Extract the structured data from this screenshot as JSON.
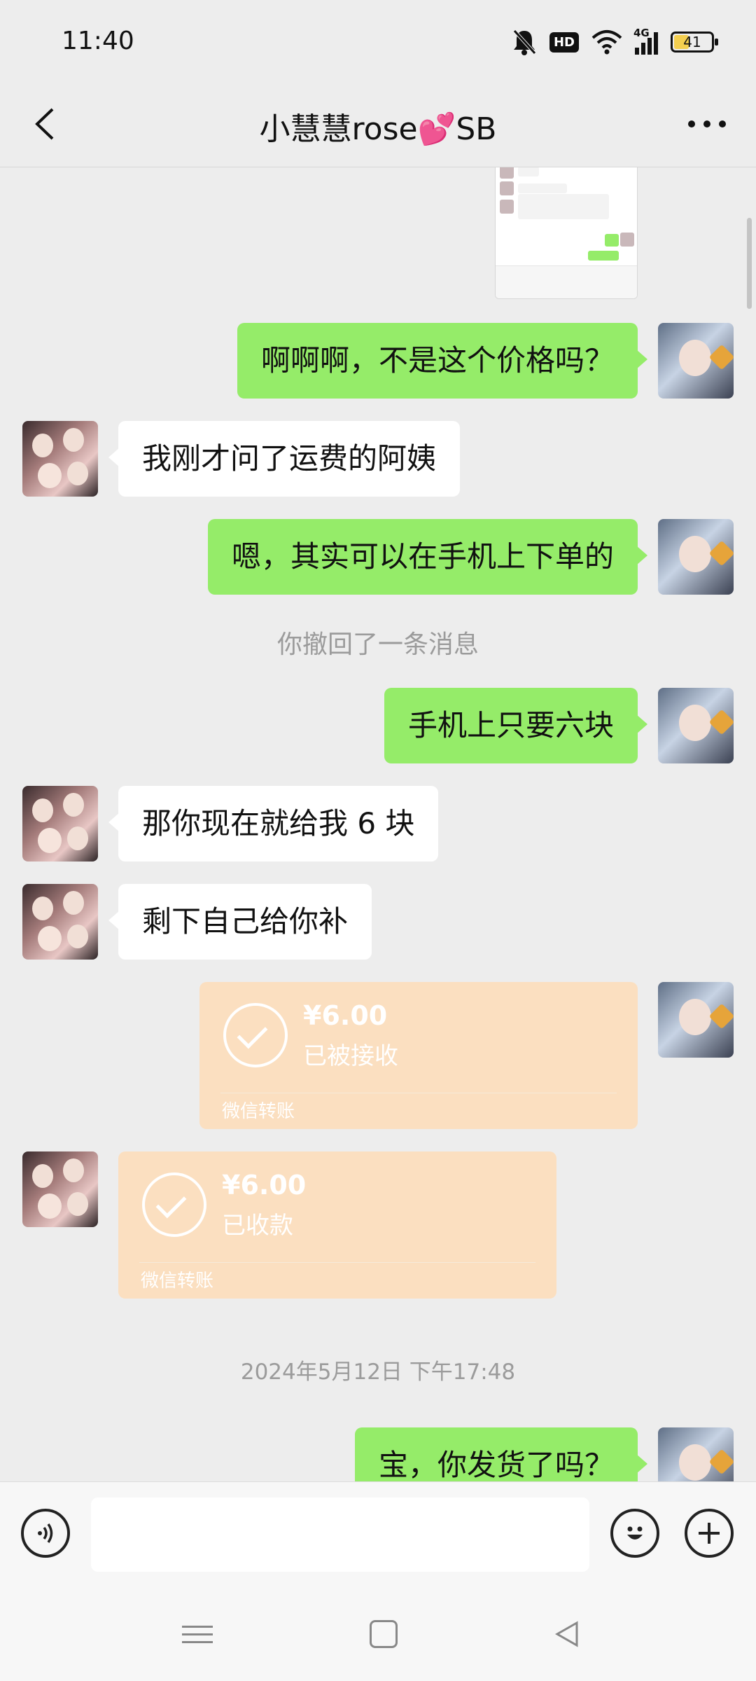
{
  "status_bar": {
    "time": "11:40",
    "network_label": "4G",
    "battery_level": "41",
    "battery_fraction": 0.41,
    "hd_label": "HD",
    "icons": [
      "mute-bell-icon",
      "hd-icon",
      "wifi-icon",
      "signal-icon",
      "battery-icon"
    ]
  },
  "header": {
    "title": "小慧慧rose💕SB",
    "back_icon": "chevron-left-icon",
    "more_icon": "more-dots-icon"
  },
  "messages": [
    {
      "id": 1,
      "from": "self",
      "type": "text",
      "text": "啊啊啊，不是这个价格吗？"
    },
    {
      "id": 2,
      "from": "other",
      "type": "text",
      "text": "我刚才问了运费的阿姨"
    },
    {
      "id": 3,
      "from": "self",
      "type": "text",
      "text": "嗯，其实可以在手机上下单的"
    },
    {
      "id": 4,
      "type": "system",
      "text": "你撤回了一条消息"
    },
    {
      "id": 5,
      "from": "self",
      "type": "text",
      "text": "手机上只要六块"
    },
    {
      "id": 6,
      "from": "other",
      "type": "text",
      "text": "那你现在就给我 6 块"
    },
    {
      "id": 7,
      "from": "other",
      "type": "text",
      "text": "剩下自己给你补"
    },
    {
      "id": 8,
      "from": "self",
      "type": "transfer",
      "amount": "¥6.00",
      "status": "已被接收",
      "label": "微信转账"
    },
    {
      "id": 9,
      "from": "other",
      "type": "transfer",
      "amount": "¥6.00",
      "status": "已收款",
      "label": "微信转账"
    },
    {
      "id": 10,
      "type": "timestamp",
      "text": "2024年5月12日 下午17:48"
    },
    {
      "id": 11,
      "from": "self",
      "type": "text",
      "text": "宝，你发货了吗？"
    }
  ],
  "input_bar": {
    "message_value": "",
    "voice_icon": "voice-icon",
    "emoji_icon": "emoji-icon",
    "plus_icon": "plus-icon"
  },
  "nav_bar": {
    "icons": [
      "menu-icon",
      "home-icon",
      "back-triangle-icon"
    ]
  },
  "colors": {
    "self_bubble": "#95ec69",
    "other_bubble": "#ffffff",
    "transfer_card": "#fbdfc0",
    "background": "#ededed"
  }
}
